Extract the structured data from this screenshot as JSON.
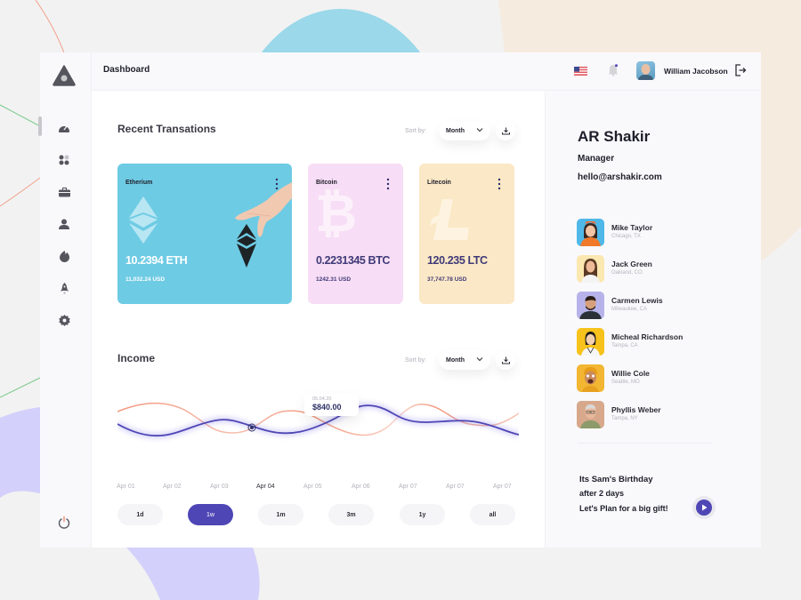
{
  "header": {
    "title": "Dashboard",
    "user_name": "William Jacobson"
  },
  "sidebar": {
    "items": [
      {
        "id": "dashboard",
        "icon": "gauge-icon",
        "active": true
      },
      {
        "id": "apps",
        "icon": "grid-icon",
        "active": false
      },
      {
        "id": "portfolio",
        "icon": "briefcase-icon",
        "active": false
      },
      {
        "id": "users",
        "icon": "user-icon",
        "active": false
      },
      {
        "id": "trending",
        "icon": "fire-icon",
        "active": false
      },
      {
        "id": "launch",
        "icon": "rocket-icon",
        "active": false
      },
      {
        "id": "settings",
        "icon": "gear-icon",
        "active": false
      }
    ],
    "power_icon": "power-icon"
  },
  "transactions": {
    "title": "Recent Transations",
    "sort_label": "Sort by:",
    "sort_value": "Month",
    "cards": [
      {
        "name": "Etherium",
        "amount": "10.2394 ETH",
        "usd": "11,032.24 USD",
        "bg": "#6ecbe4",
        "text": "#ffffff"
      },
      {
        "name": "Bitcoin",
        "amount": "0.2231345 BTC",
        "usd": "1242.31 USD",
        "bg": "#f7ddf5",
        "text": "#3f3a78"
      },
      {
        "name": "Litecoin",
        "amount": "120.235 LTC",
        "usd": "37,747.78 USD",
        "bg": "#fbe8c6",
        "text": "#3f3a78"
      }
    ]
  },
  "income": {
    "title": "Income",
    "sort_label": "Sort by:",
    "sort_value": "Month",
    "tooltip": {
      "date": "05.04.20",
      "value": "$840.00"
    },
    "x_labels": [
      "Apr 01",
      "Apr 02",
      "Apr 03",
      "Apr 04",
      "Apr 05",
      "Apr 06",
      "Apr 07",
      "Apr 07",
      "Apr 07"
    ],
    "active_label_index": 3,
    "ranges": [
      "1d",
      "1w",
      "1m",
      "3m",
      "1y",
      "all"
    ],
    "active_range": "1w",
    "colors": {
      "primary": "#4f46b5",
      "secondary": "#f08a6c"
    }
  },
  "profile": {
    "name": "AR Shakir",
    "role": "Manager",
    "email": "hello@arshakir.com"
  },
  "contacts": [
    {
      "name": "Mike Taylor",
      "location": "Chicago, TX",
      "avatar_bg": "#4fb8e8"
    },
    {
      "name": "Jack Green",
      "location": "Oakland, CO",
      "avatar_bg": "#fbe7b0"
    },
    {
      "name": "Carmen Lewis",
      "location": "Milwaukee, CA",
      "avatar_bg": "#b7b3ea"
    },
    {
      "name": "Micheal Richardson",
      "location": "Tampa, CA",
      "avatar_bg": "#f7c21b"
    },
    {
      "name": "Willie Cole",
      "location": "Seattle, MO",
      "avatar_bg": "#f2b632"
    },
    {
      "name": "Phyllis Weber",
      "location": "Tampa, NY",
      "avatar_bg": "#d7a88b"
    }
  ],
  "birthday": {
    "line1": "Its Sam's Birthday",
    "line2": "after 2 days",
    "line3": "Let's Plan for a big gift!"
  }
}
